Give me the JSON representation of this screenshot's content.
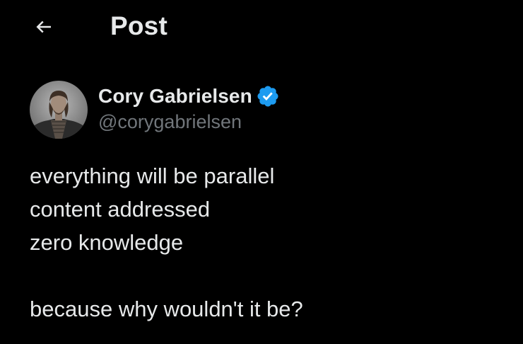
{
  "colors": {
    "background": "#000000",
    "text_primary": "#e7e9ea",
    "text_secondary": "#71767b",
    "verified_badge": "#1d9bf0"
  },
  "header": {
    "back_icon": "arrow-left-icon",
    "title": "Post"
  },
  "author": {
    "display_name": "Cory Gabrielsen",
    "handle": "@corygabrielsen",
    "verified": true,
    "verified_icon": "verified-badge-icon"
  },
  "post": {
    "lines": [
      "everything will be parallel",
      "content addressed",
      "zero knowledge",
      "",
      "because why wouldn't it be?"
    ]
  }
}
